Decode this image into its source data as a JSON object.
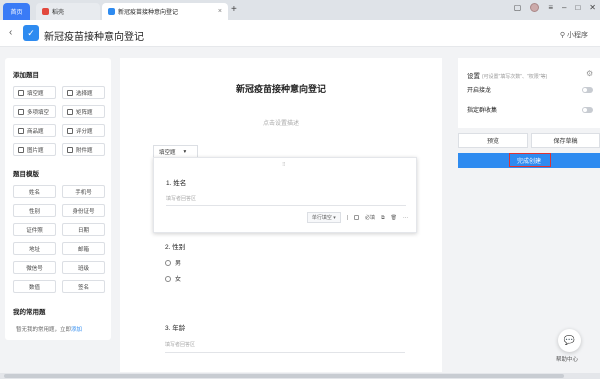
{
  "browser": {
    "tabs": [
      {
        "label": "首页"
      },
      {
        "label": "稻壳"
      },
      {
        "label": "新冠疫苗接种意向登记"
      }
    ],
    "new_tab": "+",
    "close_glyph": "×"
  },
  "header": {
    "back_glyph": "‹",
    "title": "新冠疫苗接种意向登记",
    "mini_program": "小程序"
  },
  "left_panel": {
    "add_question_title": "添加题目",
    "question_types": [
      {
        "label": "填空题"
      },
      {
        "label": "选择题"
      },
      {
        "label": "多项填空"
      },
      {
        "label": "矩阵题"
      },
      {
        "label": "商品题"
      },
      {
        "label": "评分题"
      },
      {
        "label": "图片题"
      },
      {
        "label": "附件题"
      }
    ],
    "template_title": "题目模版",
    "templates": [
      {
        "label": "姓名"
      },
      {
        "label": "手机号"
      },
      {
        "label": "性别"
      },
      {
        "label": "身份证号"
      },
      {
        "label": "证件照"
      },
      {
        "label": "日期"
      },
      {
        "label": "地址"
      },
      {
        "label": "邮箱"
      },
      {
        "label": "微信号"
      },
      {
        "label": "班级"
      },
      {
        "label": "数值"
      },
      {
        "label": "签名"
      }
    ],
    "frequent_title": "我的常用题",
    "frequent_empty": "暂无我的常用题，立即",
    "frequent_add": "添加"
  },
  "form": {
    "title": "新冠疫苗接种意向登记",
    "description_placeholder": "点击设置描述",
    "type_tab": "填空题",
    "q1": {
      "number": "1.",
      "label": "姓名",
      "placeholder": "填写者回答区"
    },
    "card_tools": {
      "input_type": "单行填空",
      "required": "必填",
      "more": "···"
    },
    "q2": {
      "number": "2.",
      "label": "性别",
      "options": [
        "男",
        "女"
      ]
    },
    "q3": {
      "number": "3.",
      "label": "年龄",
      "placeholder": "填写者回答区"
    }
  },
  "right_panel": {
    "settings_title": "设置",
    "settings_hint": "(可设置\"填写次数\"、\"权限\"等)",
    "relay": "开启接龙",
    "group_collect": "指定群收集",
    "preview": "预览",
    "save_draft": "保存草稿",
    "finish": "完成创建"
  },
  "help": {
    "label": "帮助中心"
  }
}
